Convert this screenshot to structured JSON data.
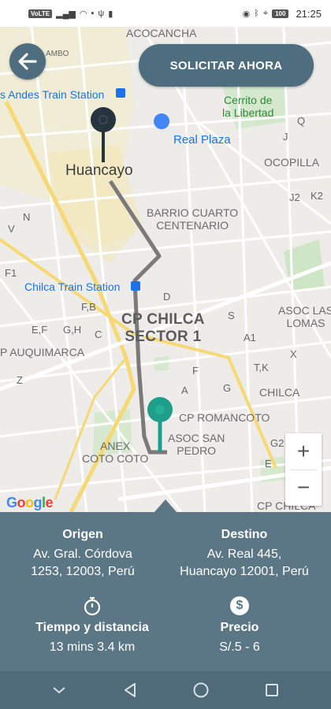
{
  "status_bar": {
    "left_chip": "VoLTE",
    "time": "21:25",
    "battery": "100"
  },
  "header": {
    "request_button_label": "SOLICITAR AHORA"
  },
  "map": {
    "labels": {
      "acocancha": "ACOCANCHA",
      "ambo": "AMBO",
      "andes_station": "s Andes Train Station",
      "cerrito": "Cerrito de\nla Libertad",
      "real_plaza": "Real Plaza",
      "q": "Q",
      "j": "J",
      "ocopilla": "OCOPILLA",
      "huancayo": "Huancayo",
      "j2": "J2",
      "k2": "K2",
      "barrio": "BARRIO CUARTO\nCENTENARIO",
      "n": "N",
      "v": "V",
      "f1": "F1",
      "chilca_station": "Chilca Train Station",
      "fb": "F,B",
      "d": "D",
      "asoc_lomas": "ASOC LAS\nLOMAS",
      "s": "S",
      "ef": "E,F",
      "gh": "G,H",
      "c": "C",
      "cp_chilca": "CP CHILCA\nSECTOR 1",
      "a1": "A1",
      "auquimarca": "P AUQUIMARCA",
      "x": "X",
      "tk": "T,K",
      "f": "F",
      "z": "Z",
      "chilca": "CHILCA",
      "a": "A",
      "g": "G",
      "romancoto": "CP ROMANCOTO",
      "anex": "ANEX\nCOTO COTO",
      "asoc_san_pedro": "ASOC SAN\nPEDRO",
      "g2": "G2",
      "e": "E",
      "cp_chilca_bottom": "CP CHILCA"
    },
    "zoom_in": "+",
    "zoom_out": "−",
    "google_letters": [
      "G",
      "o",
      "o",
      "g",
      "l",
      "e"
    ],
    "origin_pin_color": "#26343e",
    "destination_pin_color": "#1e9e8b",
    "route_color": "#7a7a7a"
  },
  "trip_info": {
    "origin_title": "Origen",
    "origin_address": "Av. Gral. Córdova\n1253, 12003, Perú",
    "destination_title": "Destino",
    "destination_address": "Av. Real 445,\nHuancayo 12001, Perú",
    "time_title": "Tiempo y distancia",
    "time_value": "13 mins 3.4 km",
    "price_title": "Precio",
    "price_value": "S/.5 - 6",
    "price_icon_symbol": "$"
  },
  "colors": {
    "accent": "#4e6e7f",
    "panel": "#5b7685",
    "nav": "#4f6a78"
  }
}
